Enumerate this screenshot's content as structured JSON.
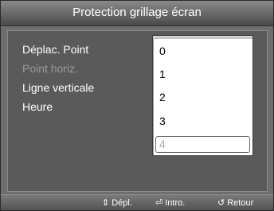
{
  "title": "Protection grillage écran",
  "menu": {
    "items": [
      {
        "label": "Déplac. Point",
        "state": "normal"
      },
      {
        "label": "Point horiz.",
        "state": "disabled"
      },
      {
        "label": "Ligne verticale",
        "state": "normal"
      },
      {
        "label": "Heure",
        "state": "normal"
      }
    ]
  },
  "dropdown": {
    "options": [
      "0",
      "1",
      "2",
      "3",
      "4"
    ],
    "focused_index": 4,
    "disabled_option": "4"
  },
  "footer": {
    "move": {
      "icon": "updown-arrows-icon",
      "label": "Dépl."
    },
    "enter": {
      "icon": "enter-icon",
      "label": "Intro."
    },
    "return": {
      "icon": "return-icon",
      "label": "Retour"
    }
  },
  "colors": {
    "background": "#6e6e6e",
    "panel": "#5a5a5a",
    "dropdown_bg": "#ffffff",
    "disabled_text": "#9a9a9a"
  }
}
